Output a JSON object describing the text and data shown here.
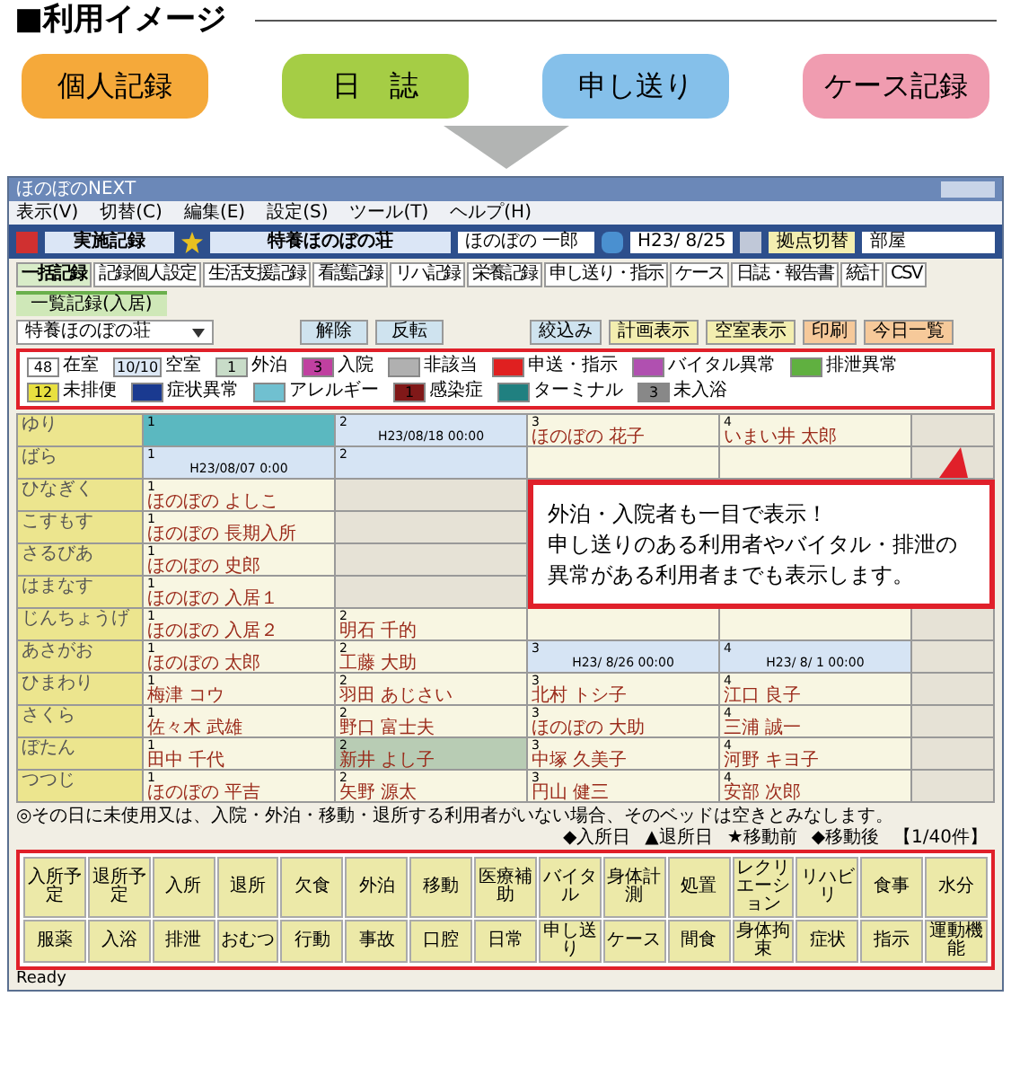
{
  "heading": "■利用イメージ",
  "features": [
    {
      "label": "個人記録",
      "color": "#f5a93a"
    },
    {
      "label": "日　誌",
      "color": "#a5cd45"
    },
    {
      "label": "申し送り",
      "color": "#85c0ea"
    },
    {
      "label": "ケース記録",
      "color": "#f09cb0"
    }
  ],
  "app": {
    "window_title": "ほのぼのNEXT",
    "menu": [
      "表示(V)",
      "切替(C)",
      "編集(E)",
      "設定(S)",
      "ツール(T)",
      "ヘルプ(H)"
    ],
    "toolbar": {
      "mode": "実施記録",
      "facility": "特養ほのぼの荘",
      "user": "ほのぼの 一郎",
      "date": "H23/ 8/25",
      "switch_button": "拠点切替",
      "location": "部屋"
    },
    "tabs": [
      {
        "label": "一括記録",
        "selected": true
      },
      {
        "label": "記録個人設定",
        "selected": false
      },
      {
        "label": "生活支援記録",
        "selected": false
      },
      {
        "label": "看護記録",
        "selected": false
      },
      {
        "label": "リハ記録",
        "selected": false
      },
      {
        "label": "栄養記録",
        "selected": false
      },
      {
        "label": "申し送り・指示",
        "selected": false
      },
      {
        "label": "ケース",
        "selected": false
      },
      {
        "label": "日誌・報告書",
        "selected": false
      },
      {
        "label": "統計",
        "selected": false
      },
      {
        "label": "CSV",
        "selected": false
      }
    ],
    "subtab": "一覧記録(入居)",
    "filter": {
      "unit": "特養ほのぼの荘",
      "buttons": [
        "解除",
        "反転"
      ],
      "actions": [
        {
          "label": "絞込み",
          "color": "#cfe3ef"
        },
        {
          "label": "計画表示",
          "color": "#f3eeb0"
        },
        {
          "label": "空室表示",
          "color": "#f3eeb0"
        },
        {
          "label": "印刷",
          "color": "#f6c99a"
        },
        {
          "label": "今日一覧",
          "color": "#f6c99a"
        }
      ]
    },
    "legend": [
      {
        "count": "48",
        "label": "在室",
        "color": "#ffffff"
      },
      {
        "count": "10/10",
        "label": "空室",
        "color": "#dce8f5"
      },
      {
        "count": "1",
        "label": "外泊",
        "color": "#c8dcc8"
      },
      {
        "count": "3",
        "label": "入院",
        "color": "#c040a0"
      },
      {
        "label": "非該当",
        "color": "#b0b0b0"
      },
      {
        "label": "申送・指示",
        "color": "#e02020"
      },
      {
        "label": "バイタル異常",
        "color": "#b050b0"
      },
      {
        "label": "排泄異常",
        "color": "#60b040"
      },
      {
        "count": "12",
        "label": "未排便",
        "color": "#e8e040"
      },
      {
        "label": "症状異常",
        "color": "#1a3a90"
      },
      {
        "label": "アレルギー",
        "color": "#70c0d0"
      },
      {
        "count": "1",
        "label": "感染症",
        "color": "#801818"
      },
      {
        "label": "ターミナル",
        "color": "#208080"
      },
      {
        "count": "3",
        "label": "未入浴",
        "color": "#888888"
      }
    ],
    "rooms": [
      {
        "name": "ゆり",
        "beds": [
          {
            "no": "1",
            "color": "#5bb8c0"
          },
          {
            "no": "2",
            "date": "H23/08/18 00:00",
            "color": "#d6e4f4"
          },
          {
            "no": "3",
            "resident": "ほのぼの 花子",
            "color": "#f8f6e2"
          },
          {
            "no": "4",
            "resident": "いまい井 太郎",
            "color": "#f8f6e2"
          }
        ]
      },
      {
        "name": "ばら",
        "beds": [
          {
            "no": "1",
            "date": "H23/08/07 0:00",
            "color": "#d6e4f4"
          },
          {
            "no": "2",
            "color": "#d6e4f4"
          },
          {
            "color": "#f8f6e2"
          },
          {
            "color": "#f8f6e2"
          }
        ]
      },
      {
        "name": "ひなぎく",
        "beds": [
          {
            "no": "1",
            "resident": "ほのぼの よしこ",
            "color": "#f8f6e2"
          },
          {
            "color": "#e6e2d6"
          }
        ]
      },
      {
        "name": "こすもす",
        "beds": [
          {
            "no": "1",
            "resident": "ほのぼの 長期入所",
            "color": "#f8f6e2"
          },
          {
            "color": "#e6e2d6"
          }
        ]
      },
      {
        "name": "さるびあ",
        "beds": [
          {
            "no": "1",
            "resident": "ほのぼの 史郎",
            "color": "#f8f6e2"
          },
          {
            "color": "#e6e2d6"
          }
        ]
      },
      {
        "name": "はまなす",
        "beds": [
          {
            "no": "1",
            "resident": "ほのぼの 入居１",
            "color": "#f8f6e2"
          },
          {
            "color": "#e6e2d6"
          }
        ]
      },
      {
        "name": "じんちょうげ",
        "beds": [
          {
            "no": "1",
            "resident": "ほのぼの 入居２",
            "color": "#f8f6e2"
          },
          {
            "no": "2",
            "resident": "明石 千的",
            "color": "#f8f6e2"
          },
          {
            "color": "#f8f6e2"
          },
          {
            "color": "#f8f6e2"
          }
        ]
      },
      {
        "name": "あさがお",
        "beds": [
          {
            "no": "1",
            "resident": "ほのぼの 太郎",
            "color": "#f8f6e2"
          },
          {
            "no": "2",
            "resident": "工藤 大助",
            "color": "#f8f6e2"
          },
          {
            "no": "3",
            "date": "H23/ 8/26 00:00",
            "color": "#d6e4f4"
          },
          {
            "no": "4",
            "date": "H23/ 8/ 1 00:00",
            "color": "#d6e4f4"
          }
        ]
      },
      {
        "name": "ひまわり",
        "beds": [
          {
            "no": "1",
            "resident": "梅津 コウ",
            "color": "#f8f6e2"
          },
          {
            "no": "2",
            "resident": "羽田 あじさい",
            "color": "#f8f6e2"
          },
          {
            "no": "3",
            "resident": "北村 トシ子",
            "color": "#f8f6e2"
          },
          {
            "no": "4",
            "resident": "江口 良子",
            "color": "#f8f6e2"
          }
        ]
      },
      {
        "name": "さくら",
        "beds": [
          {
            "no": "1",
            "resident": "佐々木 武雄",
            "color": "#f8f6e2"
          },
          {
            "no": "2",
            "resident": "野口 富士夫",
            "color": "#f8f6e2"
          },
          {
            "no": "3",
            "resident": "ほのぼの 大助",
            "color": "#f8f6e2"
          },
          {
            "no": "4",
            "resident": "三浦 誠一",
            "color": "#f8f6e2"
          }
        ]
      },
      {
        "name": "ぼたん",
        "beds": [
          {
            "no": "1",
            "resident": "田中 千代",
            "color": "#f8f6e2"
          },
          {
            "no": "2",
            "resident": "新井 よし子",
            "color": "#b8ccb4"
          },
          {
            "no": "3",
            "resident": "中塚 久美子",
            "color": "#f8f6e2"
          },
          {
            "no": "4",
            "resident": "河野 キヨ子",
            "color": "#f8f6e2"
          }
        ]
      },
      {
        "name": "つつじ",
        "beds": [
          {
            "no": "1",
            "resident": "ほのぼの 平吉",
            "color": "#f8f6e2"
          },
          {
            "no": "2",
            "resident": "矢野 源太",
            "color": "#f8f6e2"
          },
          {
            "no": "3",
            "resident": "円山 健三",
            "color": "#f8f6e2"
          },
          {
            "no": "4",
            "resident": "安部 次郎",
            "color": "#f8f6e2"
          }
        ]
      }
    ],
    "note": "◎その日に未使用又は、入院・外泊・移動・退所する利用者がいない場合、そのベッドは空きとみなします。",
    "marks": [
      "◆入所日",
      "▲退所日",
      "★移動前",
      "◆移動後"
    ],
    "count": "【1/40件】",
    "record_buttons": [
      [
        "入所予定",
        "退所予定",
        "入所",
        "退所",
        "欠食",
        "外泊",
        "移動",
        "医療補助",
        "バイタル",
        "身体計測",
        "処置",
        "レクリエーション",
        "リハビリ",
        "食事",
        "水分"
      ],
      [
        "服薬",
        "入浴",
        "排泄",
        "おむつ",
        "行動",
        "事故",
        "口腔",
        "日常",
        "申し送り",
        "ケース",
        "間食",
        "身体拘束",
        "症状",
        "指示",
        "運動機能"
      ]
    ],
    "status": "Ready"
  },
  "callout": [
    "外泊・入院者も一目で表示！",
    "申し送りのある利用者やバイタル・排泄の",
    "異常がある利用者までも表示します。"
  ]
}
